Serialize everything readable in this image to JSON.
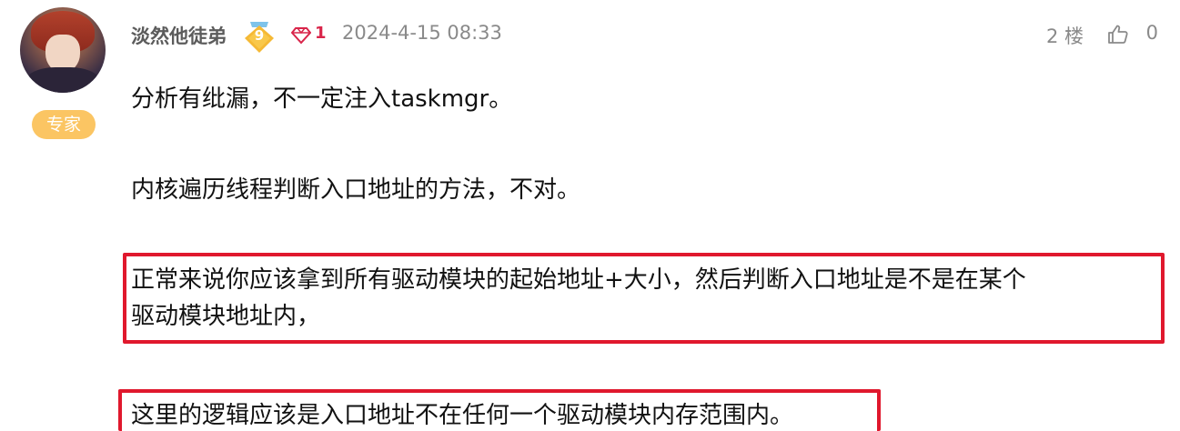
{
  "user": {
    "name": "淡然他徒弟",
    "level": "9",
    "gem_count": "1",
    "role_badge": "专家"
  },
  "post": {
    "date": "2024-4-15 08:33",
    "floor": "2 楼",
    "likes": "0",
    "paragraphs": [
      "分析有纰漏，不一定注入taskmgr。",
      "内核遍历线程判断入口地址的方法，不对。",
      "正常来说你应该拿到所有驱动模块的起始地址+大小，然后判断入口地址是不是在某个",
      "驱动模块地址内，",
      "这里的逻辑应该是入口地址不在任何一个驱动模块内存范围内。"
    ]
  },
  "colors": {
    "highlight_border": "#e0182d",
    "badge_orange": "#fbc563",
    "gem_red": "#d9254a",
    "meta_gray": "#8a8a8a"
  }
}
